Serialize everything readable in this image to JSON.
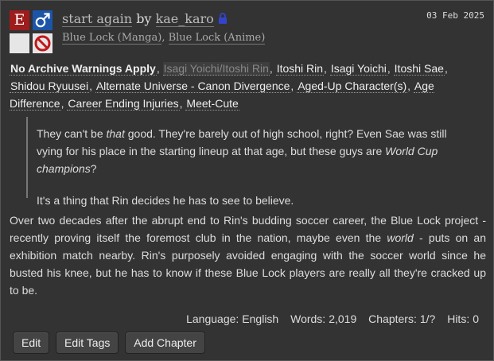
{
  "work": {
    "title": "start again",
    "by_word": "by",
    "author": "kae_karo",
    "date": "03 Feb 2025",
    "rating_glyph": "E",
    "fandoms": [
      {
        "name": "Blue Lock (Manga)",
        "sep": ", "
      },
      {
        "name": "Blue Lock (Anime)",
        "sep": ""
      }
    ]
  },
  "tags": [
    {
      "label": "No Archive Warnings Apply",
      "kind": "warning",
      "sep": ", "
    },
    {
      "label": "Isagi Yoichi/Itoshi Rin",
      "kind": "relationship",
      "sep": ", "
    },
    {
      "label": "Itoshi Rin",
      "kind": "character",
      "sep": ", "
    },
    {
      "label": "Isagi Yoichi",
      "kind": "character",
      "sep": ", "
    },
    {
      "label": "Itoshi Sae",
      "kind": "character",
      "sep": ", "
    },
    {
      "label": "Shidou Ryuusei",
      "kind": "character",
      "sep": ", "
    },
    {
      "label": "Alternate Universe - Canon Divergence",
      "kind": "freeform",
      "sep": ", "
    },
    {
      "label": "Aged-Up Character(s)",
      "kind": "freeform",
      "sep": ", "
    },
    {
      "label": "Age Difference",
      "kind": "freeform",
      "sep": ", "
    },
    {
      "label": "Career Ending Injuries",
      "kind": "freeform",
      "sep": ", "
    },
    {
      "label": "Meet-Cute",
      "kind": "freeform",
      "sep": ""
    }
  ],
  "summary": {
    "p1_a": "They can't be ",
    "p1_em1": "that",
    "p1_b": " good. They're barely out of high school, right? Even Sae was still vying for his place in the starting lineup at that age, but these guys are ",
    "p1_em2": "World Cup champions",
    "p1_c": "?",
    "p2": "It's a thing that Rin decides he has to see to believe."
  },
  "description": {
    "a": "Over two decades after the abrupt end to Rin's budding soccer career, the Blue Lock project - recently proving itself the foremost club in the nation, maybe even the ",
    "em": "world",
    "b": " - puts on an exhibition match nearby. Rin's purposely avoided engaging with the soccer world since he busted his knee, but he has to know if these Blue Lock players are really all they're cracked up to be."
  },
  "stats": {
    "language_label": "Language:",
    "language": "English",
    "words_label": "Words:",
    "words": "2,019",
    "chapters_label": "Chapters:",
    "chapters": "1/?",
    "hits_label": "Hits:",
    "hits": "0"
  },
  "actions": {
    "edit": "Edit",
    "edit_tags": "Edit Tags",
    "add_chapter": "Add Chapter"
  },
  "colors": {
    "background": "#333333",
    "rating": "#9e1c1c",
    "category": "#1c55a8",
    "lock": "#3344cc"
  },
  "icons": {
    "rating": "explicit-rating-icon",
    "category": "male-category-icon",
    "warnings": "warnings-icon",
    "complete": "work-in-progress-icon",
    "lock": "lock-icon"
  }
}
